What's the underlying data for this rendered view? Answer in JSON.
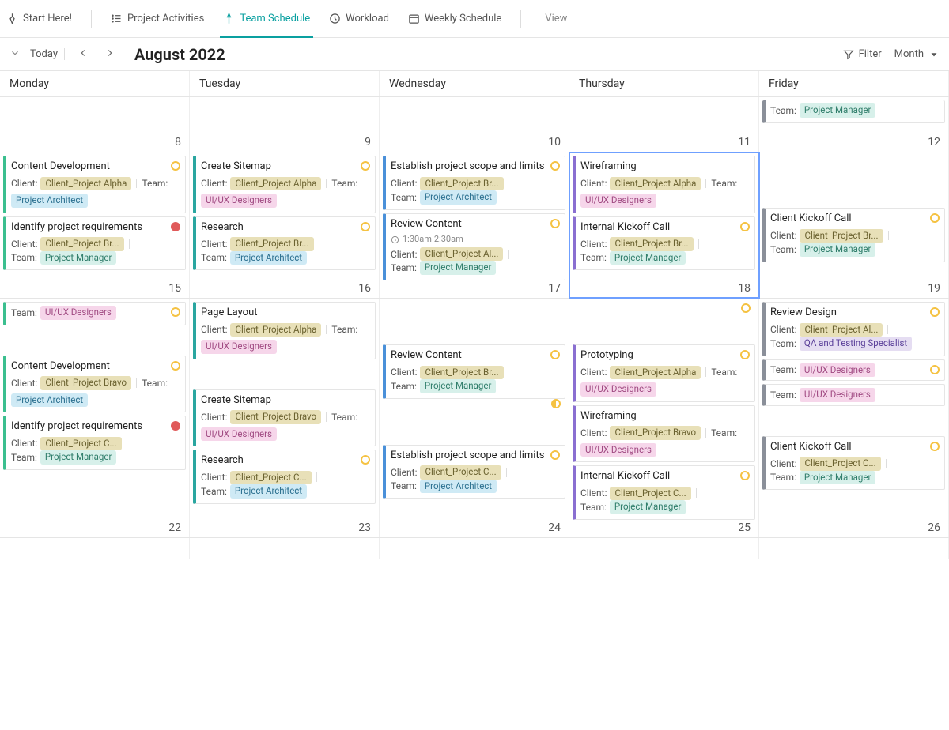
{
  "tabs": {
    "start": "Start Here!",
    "activities": "Project Activities",
    "team_schedule": "Team Schedule",
    "workload": "Workload",
    "weekly": "Weekly Schedule",
    "add_view": "View"
  },
  "toolbar": {
    "today": "Today",
    "title": "August 2022",
    "filter": "Filter",
    "month": "Month"
  },
  "day_headers": [
    "Monday",
    "Tuesday",
    "Wednesday",
    "Thursday",
    "Friday"
  ],
  "labels": {
    "client": "Client:",
    "team": "Team:"
  },
  "clients": {
    "alpha": "Client_Project Alpha",
    "bravo": "Client_Project Bravo",
    "br": "Client_Project Br...",
    "c": "Client_Project C...",
    "al": "Client_Project Al..."
  },
  "teams": {
    "architect": "Project Architect",
    "manager": "Project Manager",
    "uiux": "UI/UX Designers",
    "qa": "QA and Testing Specialist"
  },
  "week1_dates": [
    "8",
    "9",
    "10",
    "11",
    "12"
  ],
  "week2_dates": [
    "15",
    "16",
    "17",
    "18",
    "19"
  ],
  "week3_dates": [
    "22",
    "23",
    "24",
    "25",
    "26"
  ],
  "events": {
    "w1": {
      "fri_top_team": "Project Manager"
    },
    "w2": {
      "mon": [
        {
          "title": "Content Development",
          "client": "alpha",
          "team": "architect",
          "accent": "green",
          "dot": "open"
        },
        {
          "title": "Identify project requirements",
          "client": "br",
          "team": "manager",
          "accent": "green",
          "dot": "closed"
        }
      ],
      "tue": [
        {
          "title": "Create Sitemap",
          "client": "alpha",
          "team": "uiux",
          "accent": "teal",
          "dot": "open"
        },
        {
          "title": "Research",
          "client": "br",
          "team": "architect",
          "accent": "teal",
          "dot": "open"
        }
      ],
      "wed": [
        {
          "title": "Establish project scope and limits",
          "client": "br",
          "team": "architect",
          "accent": "blue",
          "dot": "open"
        },
        {
          "title": "Review Content",
          "time": "1:30am-2:30am",
          "client": "al",
          "team": "manager",
          "accent": "blue",
          "dot": "open"
        }
      ],
      "thu": [
        {
          "title": "Wireframing",
          "client": "alpha",
          "team": "uiux",
          "accent": "purple"
        },
        {
          "title": "Internal Kickoff Call",
          "client": "br",
          "team": "manager",
          "accent": "purple",
          "dot": "open"
        }
      ],
      "fri": [
        {
          "title": "Client Kickoff Call",
          "client": "br",
          "team": "manager",
          "accent": "gray",
          "dot": "open"
        }
      ]
    },
    "w3": {
      "mon": [
        {
          "title_only_team": "uiux",
          "dot": "open"
        },
        {
          "title": "Content Development",
          "client": "bravo",
          "team": "architect",
          "accent": "green",
          "dot": "open"
        },
        {
          "title": "Identify project requirements",
          "client": "c",
          "team": "manager",
          "accent": "green",
          "dot": "closed"
        }
      ],
      "tue": [
        {
          "title": "Page Layout",
          "client": "alpha",
          "team": "uiux",
          "accent": "teal"
        },
        {
          "title": "Create Sitemap",
          "client": "bravo",
          "team": "uiux",
          "accent": "teal"
        },
        {
          "title": "Research",
          "client": "c",
          "team": "architect",
          "accent": "teal",
          "dot": "open"
        }
      ],
      "wed": [
        {
          "title": "Review Content",
          "client": "br",
          "team": "manager",
          "accent": "blue",
          "dot": "open"
        },
        {
          "spacer": true,
          "dot": "prog"
        },
        {
          "title": "Establish project scope and limits",
          "client": "c",
          "team": "architect",
          "accent": "blue",
          "dot": "open"
        }
      ],
      "thu": [
        {
          "title": "Prototyping",
          "client": "alpha",
          "team": "uiux",
          "accent": "purple",
          "dot": "open"
        },
        {
          "title": "Wireframing",
          "client": "bravo",
          "team": "uiux",
          "accent": "purple"
        },
        {
          "title": "Internal Kickoff Call",
          "client": "c",
          "team": "manager",
          "accent": "purple",
          "dot": "open"
        }
      ],
      "fri": [
        {
          "title": "Review Design",
          "client": "al",
          "team": "qa",
          "accent": "gray",
          "dot": "open"
        },
        {
          "spacer_uiux": true,
          "dot": "open"
        },
        {
          "spacer_uiux": true
        },
        {
          "title": "Client Kickoff Call",
          "client": "c",
          "team": "manager",
          "accent": "gray",
          "dot": "open"
        }
      ]
    }
  }
}
